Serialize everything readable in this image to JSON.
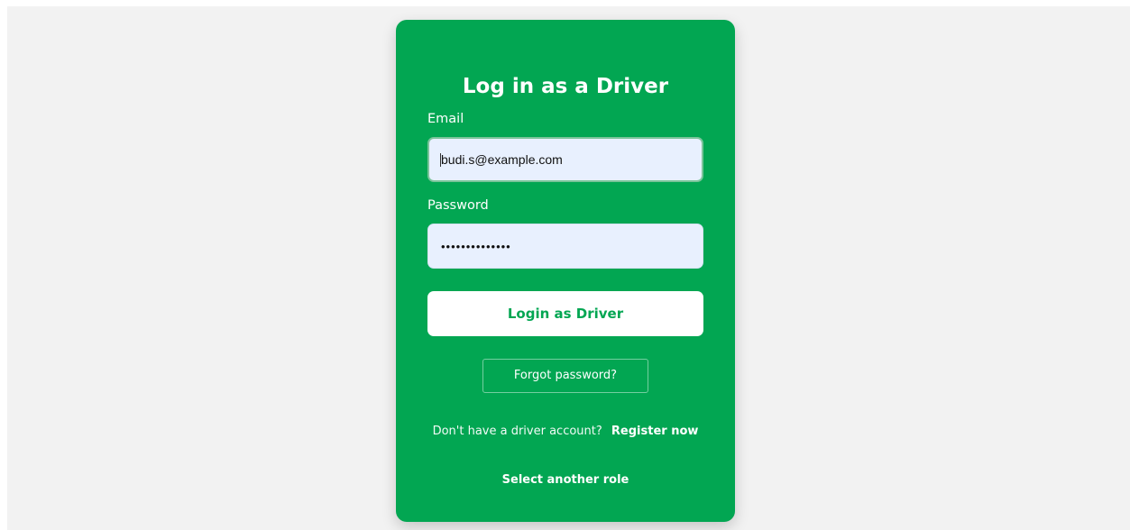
{
  "colors": {
    "page_background": "#f2f2f2",
    "card_background": "#02a652",
    "input_background": "#e8f0fe",
    "button_background": "#ffffff",
    "button_text": "#02a652",
    "text_on_card": "#ffffff"
  },
  "login_card": {
    "title": "Log in as a Driver",
    "email": {
      "label": "Email",
      "value": "budi.s@example.com"
    },
    "password": {
      "label": "Password",
      "masked_value": "••••••••••••••"
    },
    "login_button_label": "Login as Driver",
    "forgot_password_label": "Forgot password?",
    "register": {
      "prompt": "Don't have a driver account?",
      "link_label": "Register now"
    },
    "select_role_label": "Select another role"
  }
}
